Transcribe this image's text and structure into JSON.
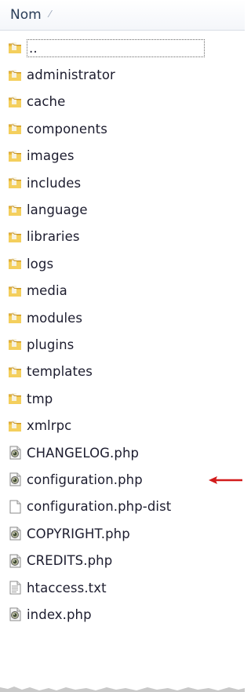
{
  "header": {
    "column_label": "Nom",
    "sort_icon": "sort-indicator-icon"
  },
  "files": [
    {
      "name": "..",
      "type": "folder",
      "selected": true
    },
    {
      "name": "administrator",
      "type": "folder"
    },
    {
      "name": "cache",
      "type": "folder"
    },
    {
      "name": "components",
      "type": "folder"
    },
    {
      "name": "images",
      "type": "folder"
    },
    {
      "name": "includes",
      "type": "folder"
    },
    {
      "name": "language",
      "type": "folder"
    },
    {
      "name": "libraries",
      "type": "folder"
    },
    {
      "name": "logs",
      "type": "folder"
    },
    {
      "name": "media",
      "type": "folder"
    },
    {
      "name": "modules",
      "type": "folder"
    },
    {
      "name": "plugins",
      "type": "folder"
    },
    {
      "name": "templates",
      "type": "folder"
    },
    {
      "name": "tmp",
      "type": "folder"
    },
    {
      "name": "xmlrpc",
      "type": "folder"
    },
    {
      "name": "CHANGELOG.php",
      "type": "php"
    },
    {
      "name": "configuration.php",
      "type": "php",
      "annotated": true
    },
    {
      "name": "configuration.php-dist",
      "type": "blank"
    },
    {
      "name": "COPYRIGHT.php",
      "type": "php"
    },
    {
      "name": "CREDITS.php",
      "type": "php"
    },
    {
      "name": "htaccess.txt",
      "type": "text"
    },
    {
      "name": "index.php",
      "type": "php"
    }
  ],
  "colors": {
    "folder": "#e8b83a",
    "arrow": "#d21b1b",
    "text": "#1c1c2e"
  }
}
